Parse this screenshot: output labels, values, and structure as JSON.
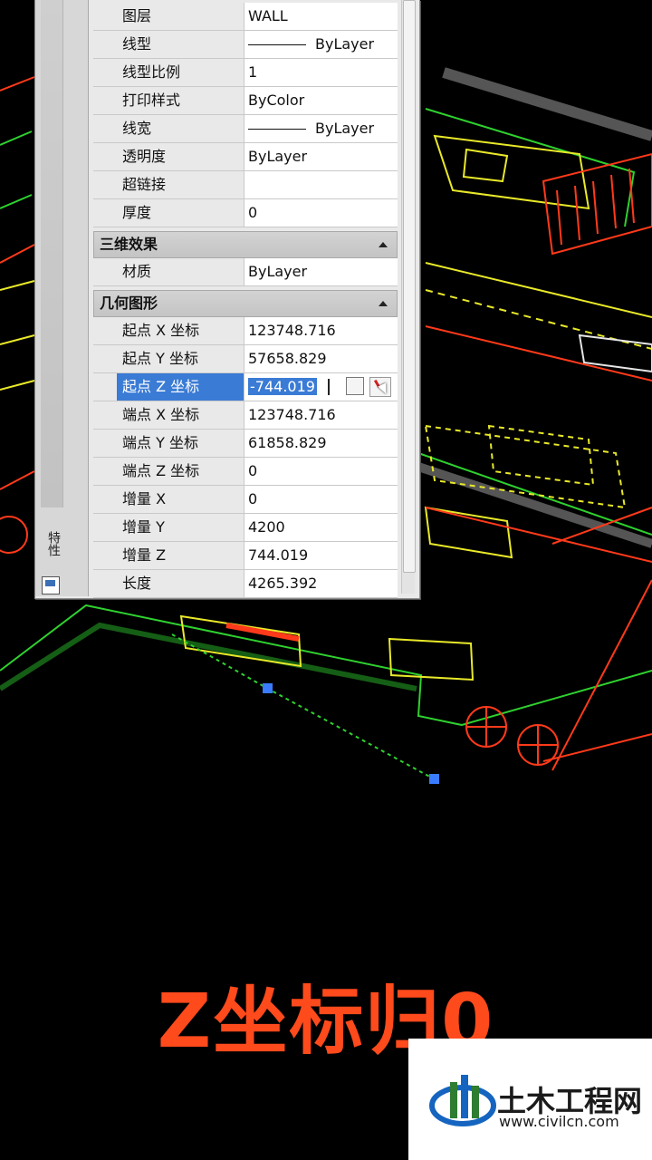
{
  "palette": {
    "side_label": "特性",
    "rows_general": [
      {
        "name": "图层",
        "value": "WALL"
      },
      {
        "name": "线型",
        "value": "ByLayer",
        "line_sample": true
      },
      {
        "name": "线型比例",
        "value": "1"
      },
      {
        "name": "打印样式",
        "value": "ByColor"
      },
      {
        "name": "线宽",
        "value": "ByLayer",
        "line_sample": true
      },
      {
        "name": "透明度",
        "value": "ByLayer"
      },
      {
        "name": "超链接",
        "value": ""
      },
      {
        "name": "厚度",
        "value": "0"
      }
    ],
    "section_3d": {
      "title": "三维效果",
      "rows": [
        {
          "name": "材质",
          "value": "ByLayer"
        }
      ]
    },
    "section_geometry": {
      "title": "几何图形",
      "rows": [
        {
          "name": "起点 X 坐标",
          "value": "123748.716"
        },
        {
          "name": "起点 Y 坐标",
          "value": "57658.829"
        },
        {
          "name": "起点 Z 坐标",
          "value": "-744.019",
          "selected": true
        },
        {
          "name": "端点 X 坐标",
          "value": "123748.716"
        },
        {
          "name": "端点 Y 坐标",
          "value": "61858.829"
        },
        {
          "name": "端点 Z 坐标",
          "value": "0"
        },
        {
          "name": "增量 X",
          "value": "0"
        },
        {
          "name": "增量 Y",
          "value": "4200"
        },
        {
          "name": "增量 Z",
          "value": "744.019"
        },
        {
          "name": "长度",
          "value": "4265.392"
        }
      ]
    }
  },
  "caption": "Z坐标归0",
  "watermark": {
    "name": "土木工程网",
    "url": "www.civilcn.com"
  },
  "colors": {
    "caption": "#ff4a1c",
    "cad_green": "#2fd12f",
    "cad_yellow": "#e9e92a",
    "cad_red": "#ff3a1a",
    "cad_white": "#e6e6e6",
    "selection_blue": "#3a7bd5",
    "grip_blue": "#3a7cff"
  }
}
